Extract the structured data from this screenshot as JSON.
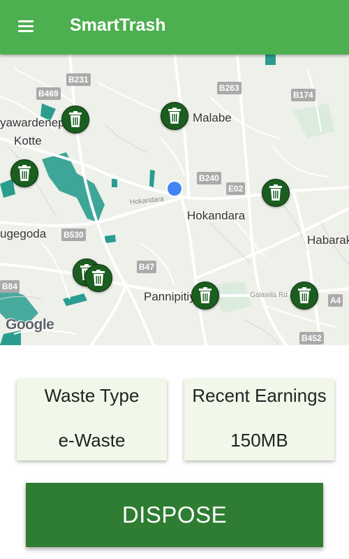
{
  "app": {
    "title": "SmartTrash"
  },
  "map": {
    "place_labels": [
      "yawardenepura",
      "Kotte",
      "Malabe",
      "Hokandara",
      "ugegoda",
      "Habarak",
      "Pannipitiya"
    ],
    "road_labels": [
      "B231",
      "B469",
      "B263",
      "B174",
      "B240",
      "E02",
      "B530",
      "B47",
      "B84",
      "A4",
      "B452"
    ],
    "street_labels": [
      "Hokandara",
      "Galawila Rd"
    ],
    "attribution": "Google",
    "marker_icon": "trash-bin-icon",
    "location_icon": "current-location-dot"
  },
  "cards": {
    "waste_type": {
      "label": "Waste Type",
      "value": "e-Waste"
    },
    "earnings": {
      "label": "Recent Earnings",
      "value": "150MB"
    }
  },
  "actions": {
    "dispose": "DISPOSE"
  },
  "colors": {
    "primary": "#4caf50",
    "primary_dark": "#2e7d32",
    "marker": "#1b5e20",
    "card": "#f1f8e9",
    "location": "#4285f4"
  }
}
